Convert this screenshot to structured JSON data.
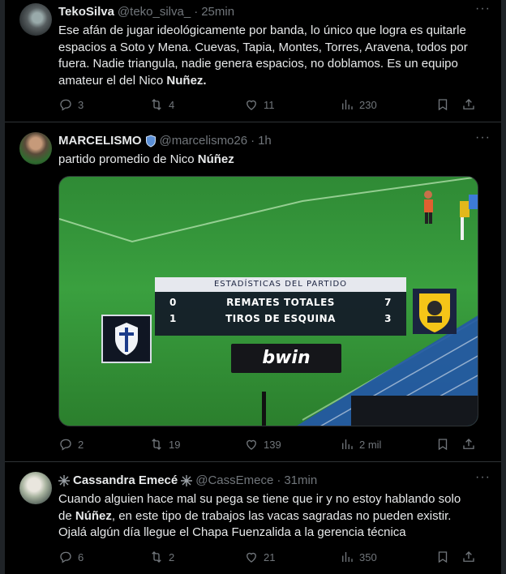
{
  "tweets": [
    {
      "name": "TekoSilva",
      "handle": "@teko_silva_",
      "sep": "·",
      "time": "25min",
      "text_lines": [
        "Ese afán de jugar ideológicamente por banda, lo único que logra es quitarle",
        "espacios a Soto y Mena. Cuevas, Tapia, Montes, Torres, Aravena, todos por",
        "fuera. Nadie triangula, nadie genera espacios, no doblamos. Es un equipo"
      ],
      "text_last_prefix": "amateur el del Nico ",
      "text_last_bold": "Nuñez.",
      "replies": "3",
      "retweets": "4",
      "likes": "11",
      "views": "230"
    },
    {
      "name": "MARCELISMO",
      "handle": "@marcelismo26",
      "sep": "·",
      "time": "1h",
      "text_prefix": "partido promedio de Nico ",
      "text_bold": "Núñez",
      "replies": "2",
      "retweets": "19",
      "likes": "139",
      "views": "2 mil",
      "media": {
        "scoreboard_title": "ESTADÍSTICAS DEL PARTIDO",
        "row1": {
          "left": "0",
          "label": "REMATES TOTALES",
          "right": "7"
        },
        "row2": {
          "left": "1",
          "label": "TIROS DE ESQUINA",
          "right": "3"
        },
        "sponsor": "bwin"
      }
    },
    {
      "name": "Cassandra Emecé",
      "handle": "@CassEmece",
      "sep": "·",
      "time": "31min",
      "line1": "Cuando alguien hace mal su pega se tiene que ir y no estoy hablando solo",
      "line2_prefix": "de ",
      "line2_bold": "Núñez",
      "line2_suffix": ", en este tipo de trabajos las vacas sagradas no pueden existir.",
      "line3": "Ojalá algún día llegue el Chapa Fuenzalida a la gerencia técnica",
      "replies": "6",
      "retweets": "2",
      "likes": "21",
      "views": "350"
    }
  ],
  "icons": {
    "more": "more-icon",
    "reply": "reply-icon",
    "retweet": "retweet-icon",
    "like": "like-icon",
    "views": "views-icon",
    "bookmark": "bookmark-icon",
    "share": "share-icon"
  },
  "colors": {
    "background": "#000000",
    "text": "#e7e9ea",
    "muted": "#71767b",
    "divider": "#2f3336",
    "verified_badge": "#5b8fd6"
  }
}
